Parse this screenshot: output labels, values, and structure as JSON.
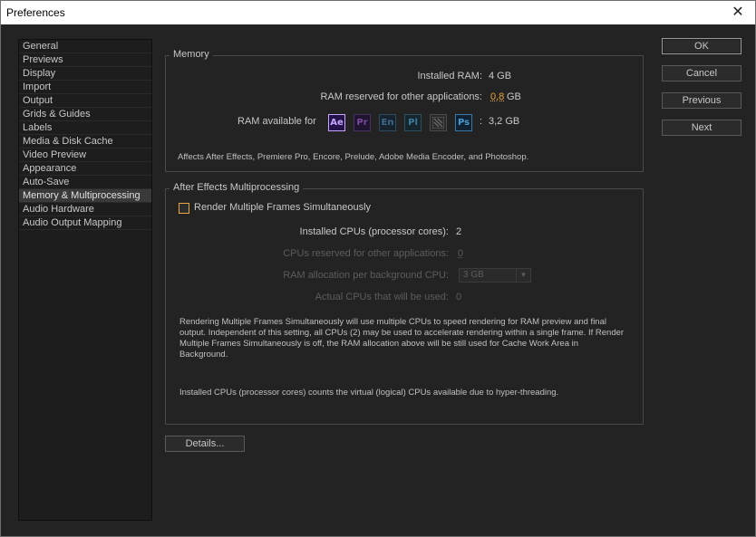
{
  "window": {
    "title": "Preferences",
    "close_glyph": "✕"
  },
  "sidebar": {
    "items": [
      "General",
      "Previews",
      "Display",
      "Import",
      "Output",
      "Grids & Guides",
      "Labels",
      "Media & Disk Cache",
      "Video Preview",
      "Appearance",
      "Auto-Save",
      "Memory & Multiprocessing",
      "Audio Hardware",
      "Audio Output Mapping"
    ],
    "selected": "Memory & Multiprocessing"
  },
  "memory": {
    "legend": "Memory",
    "installed_ram_label": "Installed RAM:",
    "installed_ram_value": "4 GB",
    "reserved_label": "RAM reserved for other applications:",
    "reserved_value": "0,8",
    "reserved_unit": "GB",
    "available_label": "RAM available for",
    "apps": [
      {
        "abbr": "Ae",
        "fg": "#c8a5ff",
        "bg": "#24134a",
        "border": "#c8a5ff"
      },
      {
        "abbr": "Pr",
        "fg": "#7a4a9a",
        "bg": "#201530",
        "border": "#4a3060"
      },
      {
        "abbr": "En",
        "fg": "#3f6a8a",
        "bg": "#16222e",
        "border": "#2f4a60"
      },
      {
        "abbr": "Pl",
        "fg": "#3f7a9a",
        "bg": "#16262e",
        "border": "#2f5060"
      },
      {
        "abbr": "",
        "fg": "#6a6a6a",
        "bg": "#2a2a2a",
        "border": "#4a4a4a"
      },
      {
        "abbr": "Ps",
        "fg": "#4a9ad0",
        "bg": "#102232",
        "border": "#3a78a8"
      }
    ],
    "available_colon": ":",
    "available_value": "3,2 GB",
    "note": "Affects After Effects, Premiere Pro, Encore, Prelude, Adobe Media Encoder, and Photoshop."
  },
  "multiprocessing": {
    "legend": "After Effects Multiprocessing",
    "render_checkbox_label": "Render Multiple Frames Simultaneously",
    "installed_cpus_label": "Installed CPUs (processor cores):",
    "installed_cpus_value": "2",
    "cpus_reserved_label": "CPUs reserved for other applications:",
    "cpus_reserved_value": "0",
    "ram_alloc_label": "RAM allocation per background CPU:",
    "ram_alloc_value": "3 GB",
    "actual_cpus_label": "Actual CPUs that will be used:",
    "actual_cpus_value": "0",
    "note_1": "Rendering Multiple Frames Simultaneously will use multiple CPUs to speed rendering for RAM preview and final output. Independent of this setting, all CPUs (2) may be used to accelerate rendering within a single frame. If Render Multiple Frames Simultaneously is off, the RAM allocation above will be still used for Cache Work Area in Background.",
    "note_2": "Installed CPUs (processor cores) counts the virtual (logical) CPUs available due to hyper-threading."
  },
  "buttons": {
    "details": "Details...",
    "ok": "OK",
    "cancel": "Cancel",
    "previous": "Previous",
    "next": "Next"
  },
  "icons": {
    "close": "close-icon",
    "dropdown": "chevron-down-icon",
    "media_encoder": "media-encoder-icon"
  }
}
